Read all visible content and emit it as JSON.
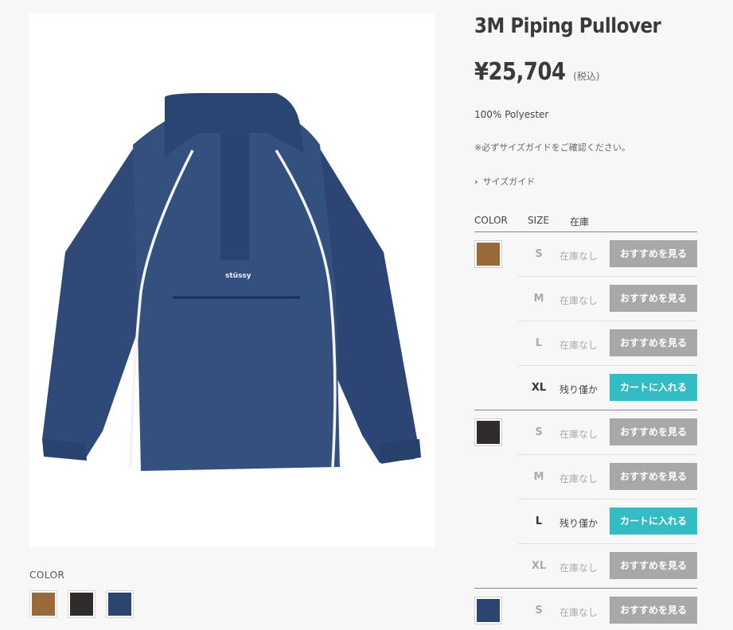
{
  "product": {
    "title": "3M Piping Pullover",
    "price": "¥25,704",
    "tax_note": "(税込)",
    "material": "100% Polyester",
    "notice": "※必ずサイズガイドをご確認ください。",
    "size_guide_label": "サイズガイド",
    "image_brand_text": "stüssy"
  },
  "colors_section": {
    "label": "COLOR",
    "swatches": [
      {
        "name": "brown",
        "color": "#9b6a3a"
      },
      {
        "name": "black",
        "color": "#2f2c2b"
      },
      {
        "name": "navy",
        "color": "#2d4470"
      }
    ]
  },
  "inventory": {
    "headers": {
      "color": "COLOR",
      "size": "SIZE",
      "stock": "在庫"
    },
    "rows": [
      {
        "size": "S",
        "stock": "在庫なし",
        "button": "おすすめを見る"
      },
      {
        "size": "M",
        "stock": "在庫なし",
        "button": "おすすめを見る"
      },
      {
        "size": "L",
        "stock": "在庫なし",
        "button": "おすすめを見る"
      },
      {
        "size": "XL",
        "stock": "残り僅か",
        "button": "カートに入れる"
      },
      {
        "size": "S",
        "stock": "在庫なし",
        "button": "おすすめを見る"
      },
      {
        "size": "M",
        "stock": "在庫なし",
        "button": "おすすめを見る"
      },
      {
        "size": "L",
        "stock": "残り僅か",
        "button": "カートに入れる"
      },
      {
        "size": "XL",
        "stock": "在庫なし",
        "button": "おすすめを見る"
      },
      {
        "size": "S",
        "stock": "在庫なし",
        "button": "おすすめを見る"
      }
    ]
  },
  "theme": {
    "cart_button": "#34bcc4",
    "recommend_button": "#a8a8a8"
  }
}
